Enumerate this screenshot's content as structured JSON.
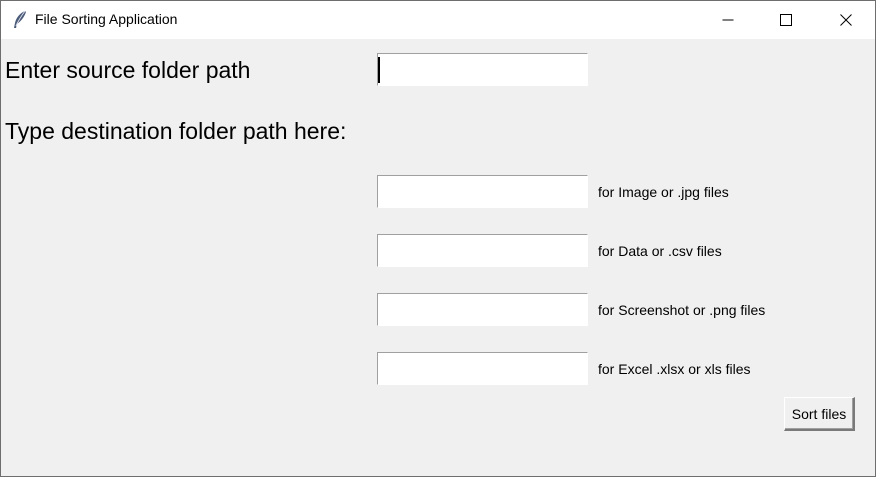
{
  "window": {
    "title": "File Sorting Application",
    "icon": "feather-icon",
    "controls": [
      "minimize-icon",
      "maximize-icon",
      "close-icon"
    ]
  },
  "source": {
    "label": "Enter source folder path",
    "value": ""
  },
  "destination": {
    "heading": "Type destination folder path here:",
    "fields": [
      {
        "label": "for Image or .jpg files",
        "value": ""
      },
      {
        "label": "for Data or .csv files",
        "value": ""
      },
      {
        "label": "for Screenshot or .png files",
        "value": ""
      },
      {
        "label": "for Excel .xlsx or xls files",
        "value": ""
      }
    ]
  },
  "actions": {
    "sort_label": "Sort files"
  }
}
